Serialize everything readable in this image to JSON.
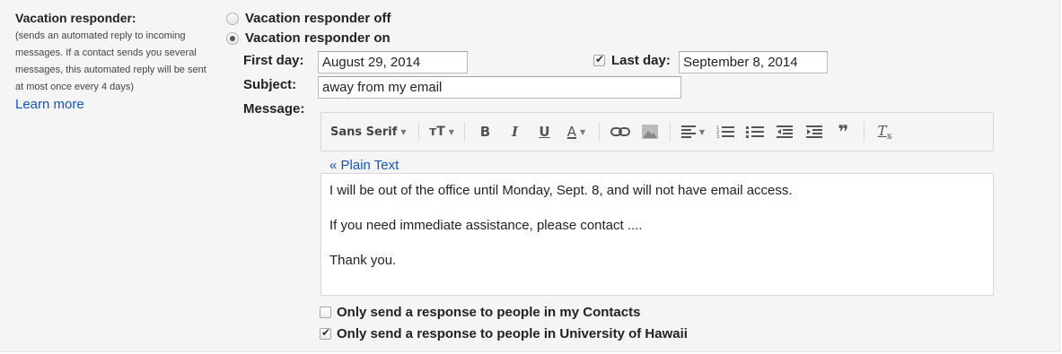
{
  "section": {
    "title": "Vacation responder:",
    "description_lines": [
      "(sends an automated reply to incoming",
      "messages. If a contact sends you several",
      "messages, this automated reply will be sent",
      "at most once every 4 days)"
    ],
    "learn_more": "Learn more"
  },
  "radios": {
    "off_label": "Vacation responder off",
    "on_label": "Vacation responder on",
    "selected": "on"
  },
  "first_day": {
    "label": "First day:",
    "value": "August 29, 2014"
  },
  "last_day": {
    "label": "Last day:",
    "value": "September 8, 2014",
    "checked": true
  },
  "subject": {
    "label": "Subject:",
    "value": "away from my email"
  },
  "message": {
    "label": "Message:",
    "plain_text_link": "« Plain Text",
    "paragraphs": [
      "I will be out of the office until Monday, Sept. 8, and will not have email access.",
      "If you need immediate assistance, please contact ....",
      "Thank you."
    ]
  },
  "toolbar": {
    "font_name": "Sans Serif",
    "icons": [
      "text-size-icon",
      "bold-icon",
      "italic-icon",
      "underline-icon",
      "text-color-icon",
      "link-icon",
      "image-icon",
      "align-icon",
      "numbered-list-icon",
      "bulleted-list-icon",
      "indent-less-icon",
      "indent-more-icon",
      "quote-icon",
      "remove-formatting-icon"
    ]
  },
  "options": {
    "contacts_only": {
      "label": "Only send a response to people in my Contacts",
      "checked": false
    },
    "domain_only": {
      "label": "Only send a response to people in University of Hawaii",
      "checked": true
    }
  }
}
